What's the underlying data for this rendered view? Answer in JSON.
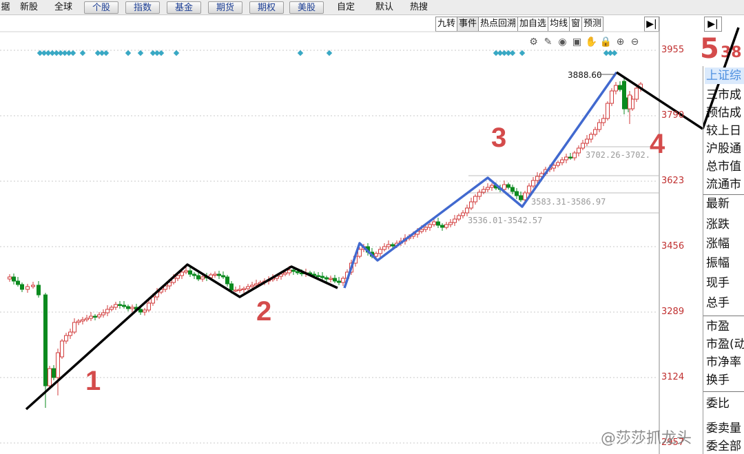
{
  "nav": {
    "items": [
      "据",
      "新股",
      "全球",
      "个股",
      "指数",
      "基金",
      "期货",
      "期权",
      "美股",
      "自定",
      "默认",
      "热搜"
    ]
  },
  "toolbar": {
    "buttons": [
      "九转",
      "事件",
      "热点回溯",
      "加自选",
      "均线",
      "窗",
      "预测"
    ],
    "collapse_icon": "▶|",
    "expand_icon": "▶|"
  },
  "chart_icons": [
    "gear-icon",
    "pen-icon",
    "eye-icon",
    "briefcase-icon",
    "hand-icon",
    "lock-icon",
    "zoom-in-icon",
    "zoom-out-icon"
  ],
  "chart_icon_glyphs": [
    "⚙",
    "✎",
    "◉",
    "▣",
    "✋",
    "🔒",
    "⊕",
    "⊖"
  ],
  "axis": {
    "labels": [
      "3955",
      "3790",
      "3623",
      "3456",
      "3289",
      "3124",
      "2957"
    ]
  },
  "annotations": {
    "peak_label": "3888.60",
    "range1": "3702.26-3702.",
    "range2": "3583.31-3586.97",
    "range3": "3536.01-3542.57",
    "wave_labels": [
      "1",
      "2",
      "3",
      "4",
      "5"
    ]
  },
  "side_panel": {
    "top_number": "38",
    "title": "上证综",
    "rows_a": [
      "三市成",
      "预估成",
      "较上日",
      "沪股通",
      "总市值",
      "流通市"
    ],
    "rows_b": [
      "最新",
      "涨跌",
      "涨幅",
      "振幅",
      "现手",
      "总手"
    ],
    "rows_c": [
      "市盈",
      "市盈(动",
      "市净率",
      "换手"
    ],
    "rows_d": [
      "委比",
      "委卖量",
      "委全部"
    ]
  },
  "watermark": "@莎莎抓龙头",
  "colors": {
    "up": "#d23b3b",
    "down": "#0a8a1e",
    "marker": "#38a8c4",
    "wave_black": "#000000",
    "wave_blue": "#4169cf",
    "wave_label": "#d44b4b"
  }
}
